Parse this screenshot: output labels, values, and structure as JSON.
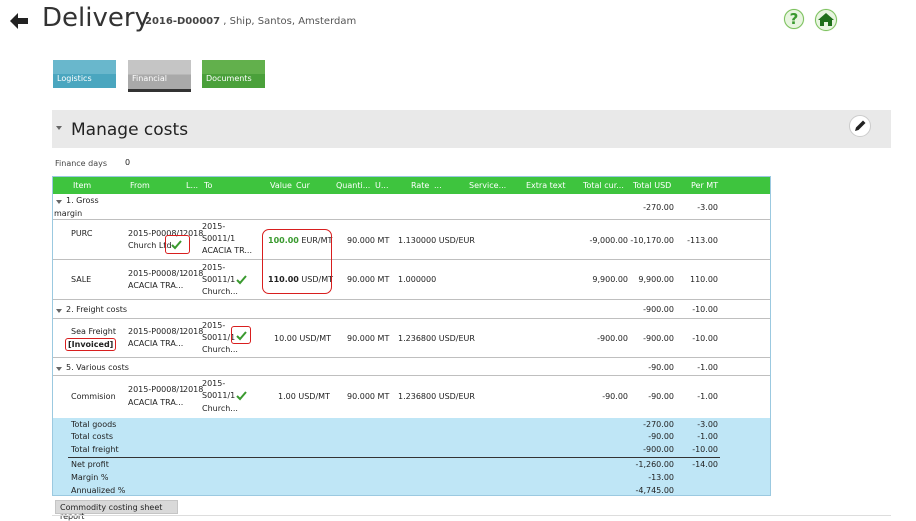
{
  "header": {
    "title": "Delivery",
    "ref": "2016-D00007",
    "details": " , Ship, Santos, Amsterdam"
  },
  "tiles": {
    "logistics": "Logistics",
    "financial": "Financial",
    "documents": "Documents"
  },
  "section": {
    "title": "Manage costs"
  },
  "finance": {
    "label": "Finance days",
    "value": "0"
  },
  "columns": [
    "Item",
    "From",
    "L...",
    "To",
    "Value",
    "Cur",
    "Quanti...",
    "U...",
    "Rate",
    "...",
    "Service...",
    "Extra text",
    "Total cur...",
    "Total USD",
    "Per MT"
  ],
  "groups": {
    "g1a": "1. Gross",
    "g1b": "margin",
    "g1_total_usd": "-270.00",
    "g1_per_mt": "-3.00",
    "g2": "2. Freight costs",
    "g2_total_usd": "-900.00",
    "g2_per_mt": "-10.00",
    "g5": "5. Various costs",
    "g5_total_usd": "-90.00",
    "g5_per_mt": "-1.00"
  },
  "rows": {
    "purc": {
      "item": "PURC",
      "from1": "2015-P0008/1",
      "from2": "Church Ltd",
      "year": "2018",
      "to1": "2015-",
      "to2": "S0011/1",
      "to3": "ACACIA TR...",
      "value": "100.00",
      "unit": "EUR/MT",
      "qty": "90.000 MT",
      "rate": "1.130000 USD/EUR",
      "total_cur": "-9,000.00",
      "total_usd": "-10,170.00",
      "per_mt": "-113.00"
    },
    "sale": {
      "item": "SALE",
      "from1": "2015-P0008/1",
      "from2": "ACACIA TRA...",
      "year": "2018",
      "to1": "2015-",
      "to2": "S0011/1",
      "to3": "Church...",
      "value": "110.00",
      "unit": "USD/MT",
      "qty": "90.000 MT",
      "rate": "1.000000",
      "total_cur": "9,900.00",
      "total_usd": "9,900.00",
      "per_mt": "110.00"
    },
    "freight": {
      "item": "Sea Freight",
      "badge": "[Invoiced]",
      "from1": "2015-P0008/1",
      "from2": "ACACIA TRA...",
      "year": "2018",
      "to1": "2015-",
      "to2": "S0011/1",
      "to3": "Church...",
      "value": "10.00 USD/MT",
      "qty": "90.000 MT",
      "rate": "1.236800 USD/EUR",
      "total_cur": "-900.00",
      "total_usd": "-900.00",
      "per_mt": "-10.00"
    },
    "commision": {
      "item": "Commision",
      "from1": "2015-P0008/1",
      "from2": "ACACIA TRA...",
      "year": "2018",
      "to1": "2015-",
      "to2": "S0011/1",
      "to3": "Church...",
      "value": "1.00 USD/MT",
      "qty": "90.000 MT",
      "rate": "1.236800 USD/EUR",
      "total_cur": "-90.00",
      "total_usd": "-90.00",
      "per_mt": "-1.00"
    }
  },
  "summary": {
    "total_goods_label": "Total goods",
    "total_goods_usd": "-270.00",
    "total_goods_mt": "-3.00",
    "total_costs_label": "Total costs",
    "total_costs_usd": "-90.00",
    "total_costs_mt": "-1.00",
    "total_freight_label": "Total freight",
    "total_freight_usd": "-900.00",
    "total_freight_mt": "-10.00",
    "net_profit_label": "Net profit",
    "net_profit_usd": "-1,260.00",
    "net_profit_mt": "-14.00",
    "margin_label": "Margin %",
    "margin_usd": "-13.00",
    "annualized_label": "Annualized %",
    "annualized_usd": "-4,745.00"
  },
  "footer": {
    "report_button": "Commodity costing sheet report"
  },
  "colors": {
    "header_green": "#3ec43e",
    "summary_blue": "#bfe6f6",
    "highlight_red": "#d81e1e",
    "value_green": "#3a9a2f"
  },
  "icons": [
    "back-arrow-icon",
    "help-icon",
    "home-icon",
    "edit-pencil-icon",
    "collapse-arrow-icon",
    "checkmark-icon"
  ]
}
